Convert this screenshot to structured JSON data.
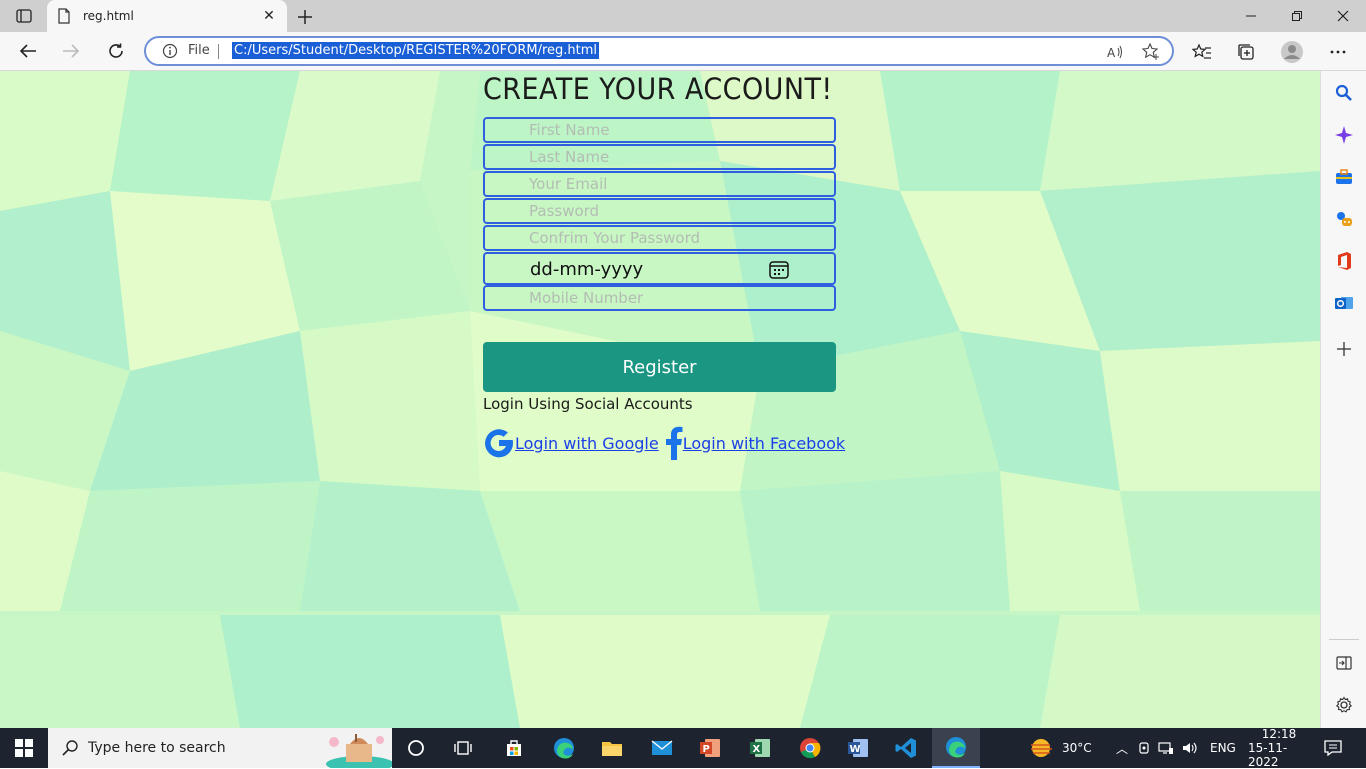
{
  "browser": {
    "tab_title": "reg.html",
    "address_scheme_label": "File",
    "url": "C:/Users/Student/Desktop/REGISTER%20FORM/reg.html"
  },
  "form": {
    "heading": "CREATE YOUR ACCOUNT!",
    "first_name_placeholder": "First Name",
    "last_name_placeholder": "Last Name",
    "email_placeholder": "Your Email",
    "password_placeholder": "Password",
    "confirm_password_placeholder": "Confrim Your Password",
    "date_value": "dd-mm-yyyy",
    "mobile_placeholder": "Mobile Number",
    "register_label": "Register",
    "social_label": "Login Using Social Accounts",
    "google_link": "Login with Google",
    "facebook_link": "Login with Facebook"
  },
  "taskbar": {
    "search_placeholder": "Type here to search",
    "temperature": "30°C",
    "language": "ENG",
    "time": "12:18",
    "date": "15-11-2022"
  }
}
